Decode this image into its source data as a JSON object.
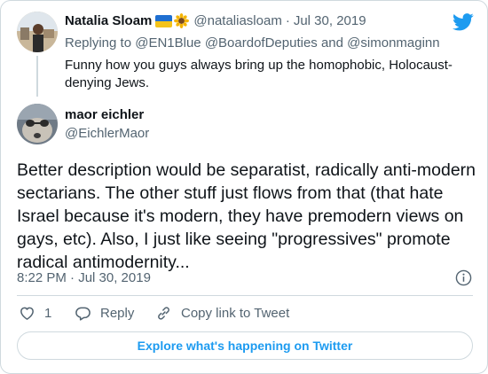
{
  "colors": {
    "accent": "#1d9bf0",
    "text": "#0f1419",
    "muted": "#536471",
    "border": "#cfd9de"
  },
  "brand": {
    "icon": "twitter-bird-icon"
  },
  "parent_tweet": {
    "display_name": "Natalia Sloam",
    "emoji": [
      "ukraine-flag-icon",
      "sunflower-icon"
    ],
    "handle": "@nataliasloam",
    "separator": "·",
    "date": "Jul 30, 2019",
    "replying_to_label": "Replying to",
    "replying_to": [
      "@EN1Blue",
      "@BoardofDeputies",
      "@simonmaginn"
    ],
    "replying_to_and": "and",
    "text": "Funny how you guys always bring up the homophobic, Holocaust-denying Jews."
  },
  "main_tweet": {
    "display_name": "maor eichler",
    "handle": "@EichlerMaor",
    "text": "Better description would be separatist, radically anti-modern sectarians. The other stuff just flows from that (that hate Israel because it's modern, they have premodern views on gays, etc). Also, I just like seeing \"progressives\" promote radical antimodernity...",
    "timestamp": "8:22 PM · Jul 30, 2019"
  },
  "actions": {
    "like_count": "1",
    "reply_label": "Reply",
    "copy_label": "Copy link to Tweet"
  },
  "explore_label": "Explore what's happening on Twitter"
}
